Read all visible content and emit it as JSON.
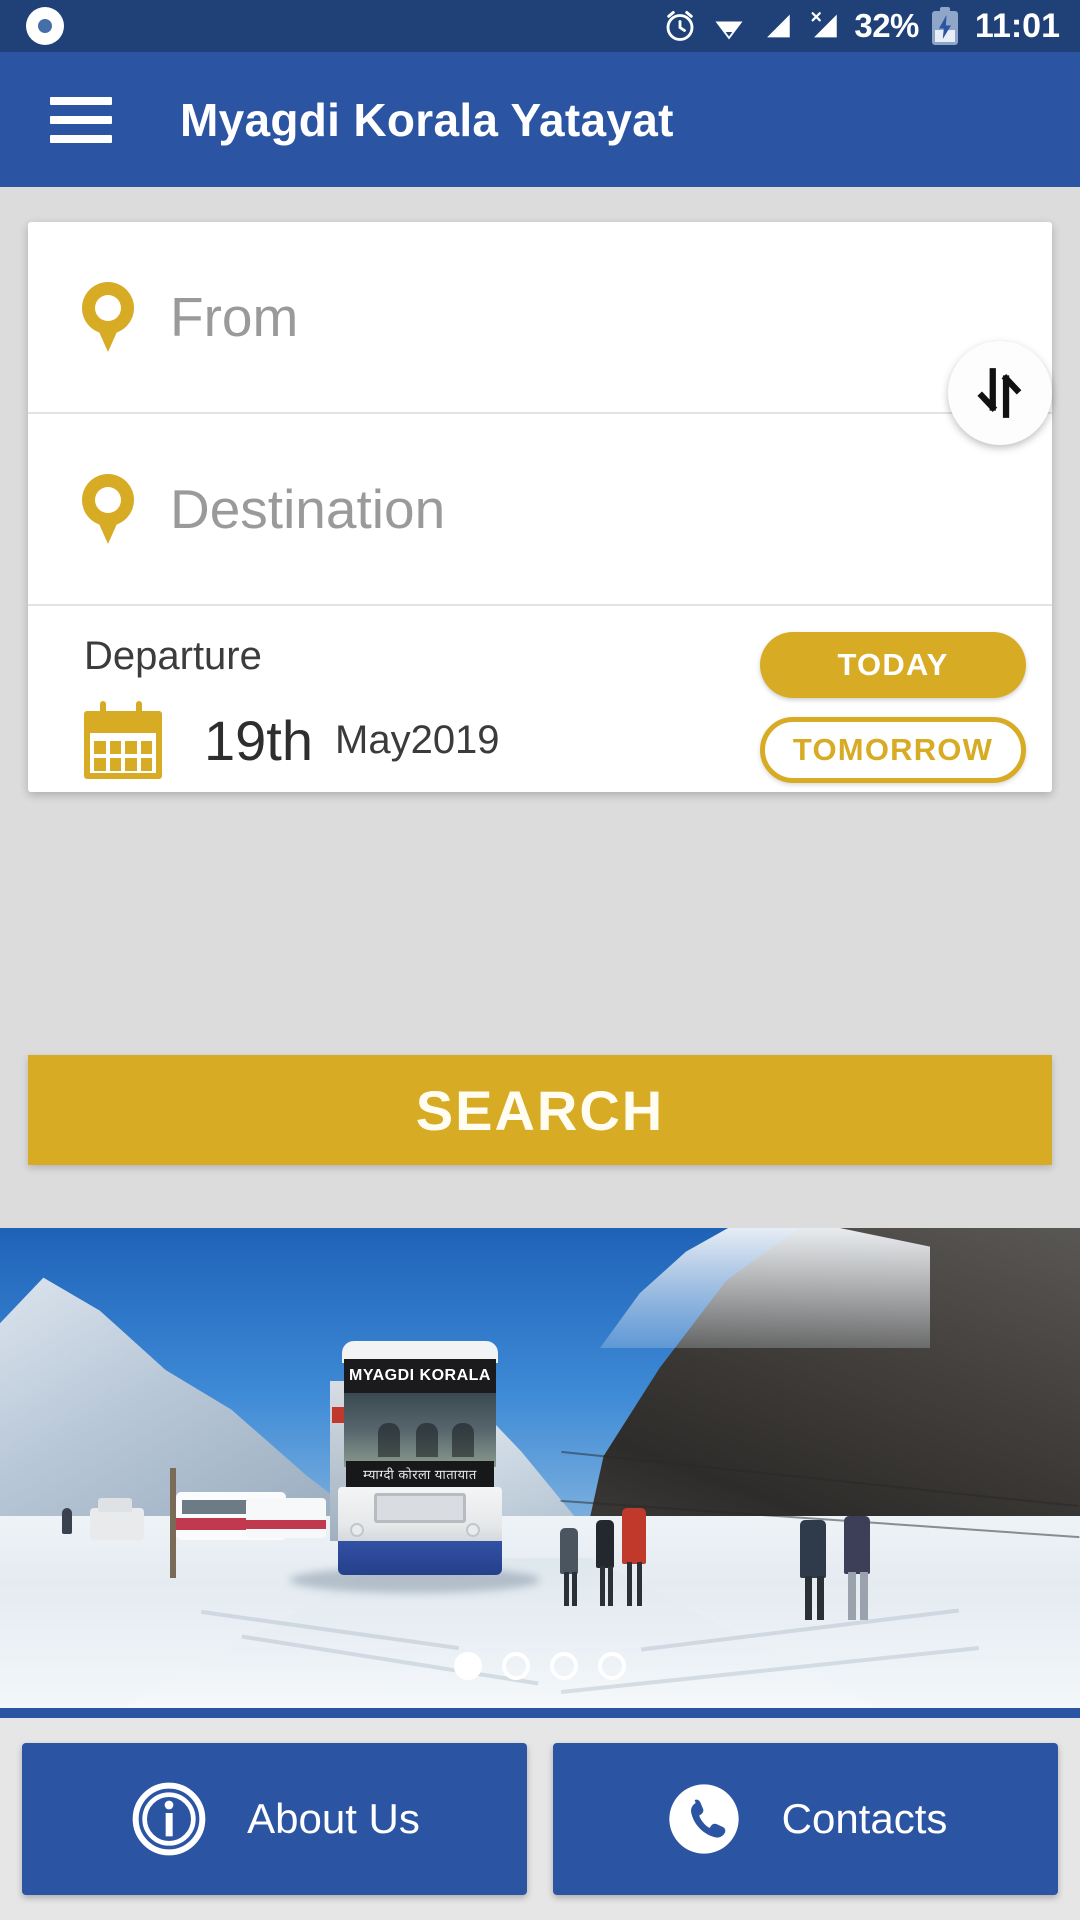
{
  "statusbar": {
    "battery_percent": "32%",
    "time": "11:01",
    "icons": [
      "record-icon",
      "alarm-icon",
      "wifi-icon",
      "signal-icon",
      "signal-no-sim-icon",
      "battery-charging-icon"
    ]
  },
  "appbar": {
    "menu_icon": "hamburger-menu-icon",
    "title": "Myagdi Korala Yatayat"
  },
  "search_card": {
    "from": {
      "placeholder": "From",
      "value": "",
      "icon": "location-pin-icon"
    },
    "destination": {
      "placeholder": "Destination",
      "value": "",
      "icon": "location-pin-icon"
    },
    "swap_icon": "swap-arrows-icon",
    "departure": {
      "label": "Departure",
      "calendar_icon": "calendar-icon",
      "day": "19th",
      "month_year": "May2019",
      "today_label": "TODAY",
      "tomorrow_label": "TOMORROW"
    }
  },
  "search_button": {
    "label": "SEARCH"
  },
  "carousel": {
    "bus_board_text": "MYAGDI KORALA",
    "bus_nepali_text": "म्याग्दी कोरला यातायात",
    "total_slides": 4,
    "active_slide": 1
  },
  "bottom_bar": {
    "about": {
      "label": "About Us",
      "icon": "info-circle-icon"
    },
    "contacts": {
      "label": "Contacts",
      "icon": "phone-icon"
    }
  },
  "colors": {
    "status_bar": "#1f4178",
    "app_bar": "#2b54a3",
    "accent_gold": "#d8ab25",
    "page_background": "#dcdcdc",
    "card_background": "#ffffff",
    "placeholder_text": "#9a9a9a"
  }
}
